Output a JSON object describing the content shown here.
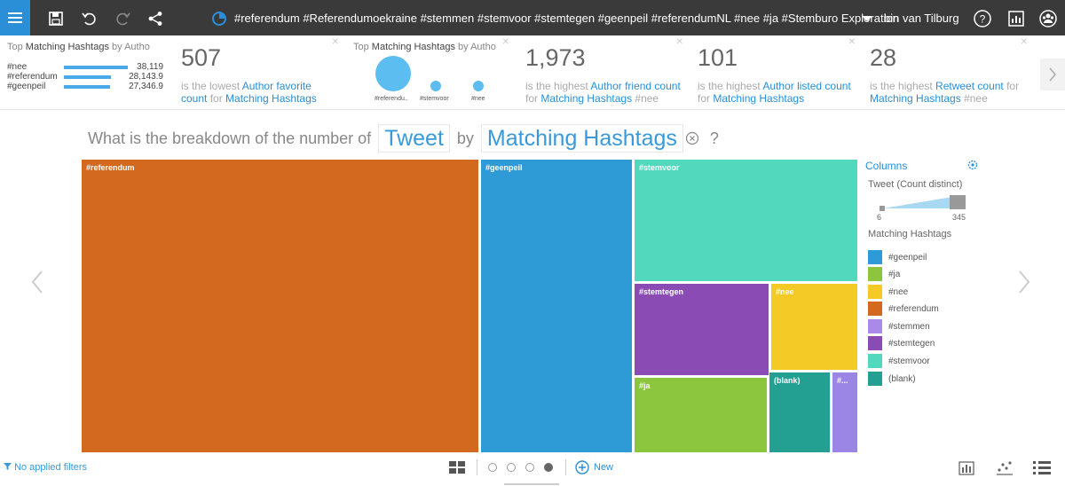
{
  "topbar": {
    "title": "#referendum #Referendumoekraine #stemmen #stemvoor #stemtegen #geenpeil #referendumNL #nee #ja #Stemburo Exploration",
    "user": "bin van Tilburg",
    "icons": [
      "menu-icon",
      "save-icon",
      "undo-icon",
      "redo-icon",
      "share-icon",
      "compass-icon",
      "chevron-down-icon",
      "help-icon",
      "chart-icon",
      "user-group-icon"
    ]
  },
  "kpis": {
    "mini_bars": {
      "title_prefix": "Top ",
      "title_field": "Matching Hashtags",
      "title_suffix": " by Autho",
      "rows": [
        {
          "label": "#nee",
          "value": "38,119",
          "fraction": 1.0
        },
        {
          "label": "#referendum",
          "value": "28,143.9",
          "fraction": 0.738
        },
        {
          "label": "#geenpeil",
          "value": "27,346.9",
          "fraction": 0.717
        }
      ]
    },
    "card1": {
      "value": "507",
      "d1": "is the lowest ",
      "d2": "Author favorite count",
      "d3": " for ",
      "d4": "Matching Hashtags"
    },
    "bubbles": {
      "title_prefix": "Top ",
      "title_field": "Matching Hashtags",
      "title_suffix": " by Autho",
      "labels": [
        "#referendu..",
        "#stemvoor",
        "#nee"
      ]
    },
    "card2": {
      "value": "1,973",
      "d1": "is the highest ",
      "d2": "Author friend count",
      "d3": " for ",
      "d4": "Matching Hashtags",
      "d5": " #nee"
    },
    "card3": {
      "value": "101",
      "d1": "is the highest ",
      "d2": "Author listed count",
      "d3": " for ",
      "d4": "Matching Hashtags"
    },
    "card4": {
      "value": "28",
      "d1": "is the highest ",
      "d2": "Retweet count",
      "d3": " for ",
      "d4": "Matching Hashtags",
      "d5": " #nee"
    }
  },
  "question": {
    "prefix": "What is the breakdown of the number of",
    "measure": "Tweet",
    "by": "by",
    "dimension": "Matching Hashtags",
    "suffix": "?"
  },
  "chart_data": {
    "type": "treemap",
    "measure": "Tweet (Count distinct)",
    "color_dimension": "Matching Hashtags",
    "cells": [
      {
        "label": "#referendum",
        "color": "#d2691e"
      },
      {
        "label": "#geenpeil",
        "color": "#2e9ad6"
      },
      {
        "label": "#stemvoor",
        "color": "#52d9bd"
      },
      {
        "label": "#stemtegen",
        "color": "#8a4bb5"
      },
      {
        "label": "#nee",
        "color": "#f4ca26"
      },
      {
        "label": "#ja",
        "color": "#8cc63f"
      },
      {
        "label": "(blank)",
        "color": "#24a093"
      },
      {
        "label": "#...",
        "color": "#9b86e6"
      }
    ],
    "range": {
      "min": "6",
      "max": "345"
    }
  },
  "legend": {
    "header": "Columns",
    "size_title": "Tweet (Count distinct)",
    "color_title": "Matching Hashtags",
    "items": [
      {
        "label": "#geenpeil",
        "color": "#2e9ad6"
      },
      {
        "label": "#ja",
        "color": "#8cc63f"
      },
      {
        "label": "#nee",
        "color": "#f4ca26"
      },
      {
        "label": "#referendum",
        "color": "#d2691e"
      },
      {
        "label": "#stemmen",
        "color": "#a98ae8"
      },
      {
        "label": "#stemtegen",
        "color": "#8a4bb5"
      },
      {
        "label": "#stemvoor",
        "color": "#52d9bd"
      },
      {
        "label": "(blank)",
        "color": "#24a093"
      }
    ]
  },
  "footer": {
    "filters": "No applied filters",
    "new_label": "New",
    "pages": 4,
    "active_page": 4
  }
}
